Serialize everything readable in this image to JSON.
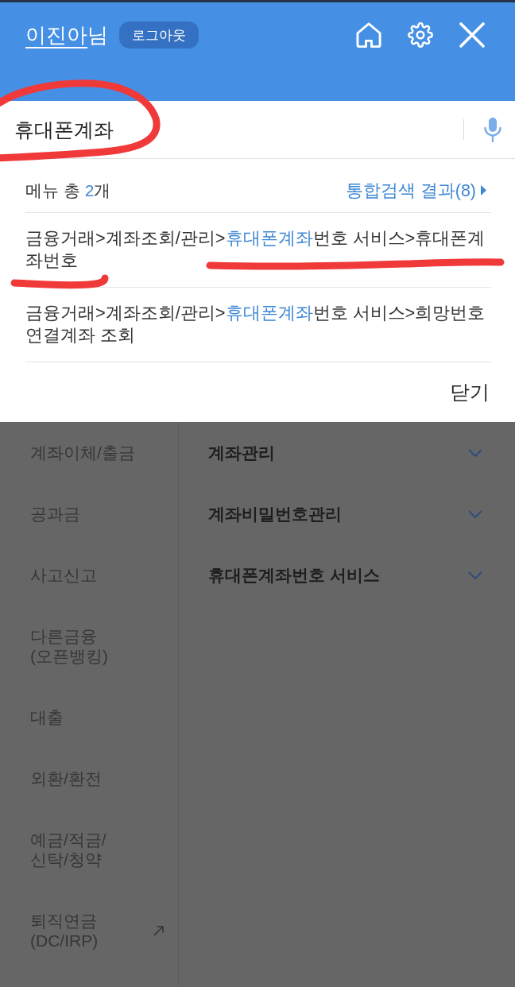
{
  "header": {
    "user_name": "이진아",
    "honorific": "님",
    "logout_button": "로그아웃"
  },
  "search": {
    "value": "휴대폰계좌",
    "circled": true
  },
  "results": {
    "count": [
      {
        "text": "메뉴 총 ",
        "highlight": false
      },
      {
        "text": "2",
        "highlight": true
      },
      {
        "text": "개",
        "highlight": false
      }
    ],
    "all_results_link": "통합검색 결과(8)",
    "items": [
      {
        "segments": [
          {
            "text": "금융거래>계좌조회/관리>",
            "highlight": false
          },
          {
            "text": "휴대폰계좌",
            "highlight": true
          },
          {
            "text": "번호 서비스>휴대폰계좌번호",
            "highlight": false
          }
        ],
        "underlined": true
      },
      {
        "segments": [
          {
            "text": "금융거래>계좌조회/관리>",
            "highlight": false
          },
          {
            "text": "휴대폰계좌",
            "highlight": true
          },
          {
            "text": "번호 서비스>희망번호 연결계좌 조회",
            "highlight": false
          }
        ],
        "underlined": false
      }
    ],
    "close_button": "닫기"
  },
  "menu": {
    "categories": [
      {
        "label": "계좌이체/출금",
        "external": false
      },
      {
        "label": "공과금",
        "external": false
      },
      {
        "label": "사고신고",
        "external": false
      },
      {
        "label": "다른금융(오픈뱅킹)",
        "external": false
      },
      {
        "label": "대출",
        "external": false
      },
      {
        "label": "외환/환전",
        "external": false
      },
      {
        "label": "예금/적금/신탁/청약",
        "external": false
      },
      {
        "label": "퇴직연금(DC/IRP)",
        "external": true
      }
    ],
    "subcategories": [
      {
        "label": "계좌관리",
        "expanded": false
      },
      {
        "label": "계좌비밀번호관리",
        "expanded": false
      },
      {
        "label": "휴대폰계좌번호 서비스",
        "expanded": false
      }
    ]
  }
}
